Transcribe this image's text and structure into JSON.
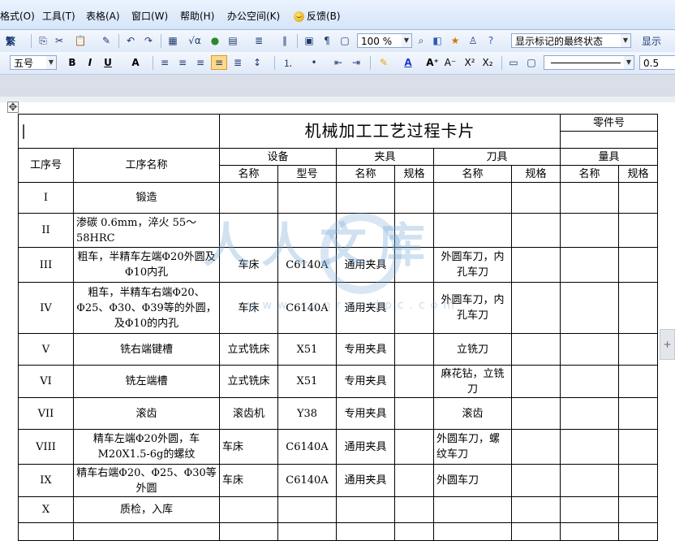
{
  "menu": [
    "格式(O)",
    "工具(T)",
    "表格(A)",
    "窗口(W)",
    "帮助(H)",
    "办公空间(K)",
    "反馈(B)"
  ],
  "toolbar1": {
    "convert_label": "繁",
    "zoom_value": "100 %",
    "markup_state": "显示标记的最终状态",
    "show_label": "显示"
  },
  "toolbar2": {
    "font_size": "五号",
    "bold": "B",
    "italic": "I",
    "underline": "U",
    "line_weight": "0.5"
  },
  "card": {
    "title": "机械加工工艺过程卡片",
    "part_no_label": "零件号",
    "col_op_no": "工序号",
    "col_op_name": "工序名称",
    "grp_equipment": "设备",
    "grp_fixture": "夹具",
    "grp_tool": "刀具",
    "grp_gauge": "量具",
    "sub_name": "名称",
    "sub_model": "型号",
    "sub_spec": "规格",
    "rows": [
      {
        "no": "I",
        "name": "锻造",
        "eq_name": "",
        "eq_model": "",
        "fix_name": "",
        "tool_name": ""
      },
      {
        "no": "II",
        "name": "渗碳 0.6mm，淬火 55～58HRC",
        "eq_name": "",
        "eq_model": "",
        "fix_name": "",
        "tool_name": ""
      },
      {
        "no": "III",
        "name": "粗车，半精车左端Φ20外圆及Φ10内孔",
        "eq_name": "车床",
        "eq_model": "C6140A",
        "fix_name": "通用夹具",
        "tool_name": "外圆车刀，内孔车刀"
      },
      {
        "no": "IV",
        "name": "粗车，半精车右端Φ20、Φ25、Φ30、Φ39等的外圆，及Φ10的内孔",
        "eq_name": "车床",
        "eq_model": "C6140A",
        "fix_name": "通用夹具",
        "tool_name": "外圆车刀，内孔车刀"
      },
      {
        "no": "V",
        "name": "铣右端键槽",
        "eq_name": "立式铣床",
        "eq_model": "X51",
        "fix_name": "专用夹具",
        "tool_name": "立铣刀"
      },
      {
        "no": "VI",
        "name": "铣左端槽",
        "eq_name": "立式铣床",
        "eq_model": "X51",
        "fix_name": "专用夹具",
        "tool_name": "麻花钻，立铣刀"
      },
      {
        "no": "VII",
        "name": "滚齿",
        "eq_name": "滚齿机",
        "eq_model": "Y38",
        "fix_name": "专用夹具",
        "tool_name": "滚齿"
      },
      {
        "no": "VIII",
        "name": "精车左端Φ20外圆，车M20X1.5-6g的螺纹",
        "eq_name": "车床",
        "eq_model": "C6140A",
        "fix_name": "通用夹具",
        "tool_name": "外圆车刀，螺纹车刀"
      },
      {
        "no": "IX",
        "name": "精车右端Φ20、Φ25、Φ30等外圆",
        "eq_name": "车床",
        "eq_model": "C6140A",
        "fix_name": "通用夹具",
        "tool_name": "外圆车刀"
      },
      {
        "no": "X",
        "name": "质检，入库",
        "eq_name": "",
        "eq_model": "",
        "fix_name": "",
        "tool_name": ""
      }
    ]
  },
  "watermark": {
    "text": "人人文库",
    "url": "www.renrendoc.com"
  }
}
